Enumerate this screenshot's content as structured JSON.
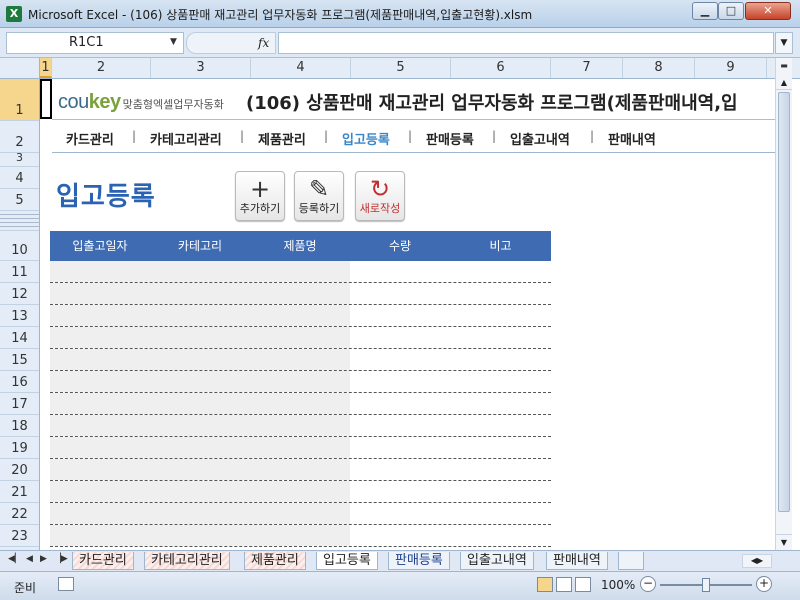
{
  "window": {
    "app_icon": "X",
    "title": "Microsoft Excel - (106) 상품판매 재고관리 업무자동화 프로그램(제품판매내역,입출고현황).xlsm",
    "minimize": "▁",
    "maximize": "□",
    "close": "✕"
  },
  "formula_bar": {
    "name_box": "R1C1",
    "fx": "fx",
    "formula": ""
  },
  "columns": [
    "1",
    "2",
    "3",
    "4",
    "5",
    "6",
    "7",
    "8",
    "9"
  ],
  "rows": [
    "1",
    "2",
    "3",
    "4",
    "5",
    "10",
    "11",
    "12",
    "13",
    "14",
    "15",
    "16",
    "17",
    "18",
    "19",
    "20",
    "21",
    "22",
    "23"
  ],
  "header": {
    "logo_brand_a": "cou",
    "logo_brand_b": "key",
    "logo_sub": "맞춤형엑셀업무자동화",
    "program_title": "(106) 상품판매 재고관리 업무자동화 프로그램(제품판매내역,입"
  },
  "nav": {
    "items": [
      "카드관리",
      "카테고리관리",
      "제품관리",
      "입고등록",
      "판매등록",
      "입출고내역",
      "판매내역"
    ],
    "separator": "|",
    "active": "입고등록"
  },
  "page": {
    "heading": "입고등록",
    "buttons": {
      "add": {
        "glyph": "+",
        "label": "추가하기",
        "icon": "plus-icon"
      },
      "register": {
        "glyph": "✎",
        "label": "등록하기",
        "icon": "pencil-icon"
      },
      "reset": {
        "glyph": "↻",
        "label": "새로작성",
        "icon": "refresh-icon"
      }
    }
  },
  "table": {
    "columns": [
      "입출고일자",
      "카테고리",
      "제품명",
      "수량",
      "비고"
    ],
    "rows": [
      [
        "",
        "",
        "",
        "",
        ""
      ],
      [
        "",
        "",
        "",
        "",
        ""
      ],
      [
        "",
        "",
        "",
        "",
        ""
      ],
      [
        "",
        "",
        "",
        "",
        ""
      ],
      [
        "",
        "",
        "",
        "",
        ""
      ],
      [
        "",
        "",
        "",
        "",
        ""
      ],
      [
        "",
        "",
        "",
        "",
        ""
      ],
      [
        "",
        "",
        "",
        "",
        ""
      ],
      [
        "",
        "",
        "",
        "",
        ""
      ],
      [
        "",
        "",
        "",
        "",
        ""
      ],
      [
        "",
        "",
        "",
        "",
        ""
      ],
      [
        "",
        "",
        "",
        "",
        ""
      ],
      [
        "",
        "",
        "",
        "",
        ""
      ]
    ]
  },
  "sheet_tabs": [
    "카드관리",
    "카테고리관리",
    "제품관리",
    "입고등록",
    "판매등록",
    "입출고내역",
    "판매내역"
  ],
  "status": {
    "ready": "준비",
    "zoom": "100%",
    "zoom_minus": "−",
    "zoom_plus": "+"
  },
  "colors": {
    "accent_blue": "#2b63b3",
    "table_header": "#3f6bb2",
    "nav_active": "#3a86c8"
  }
}
